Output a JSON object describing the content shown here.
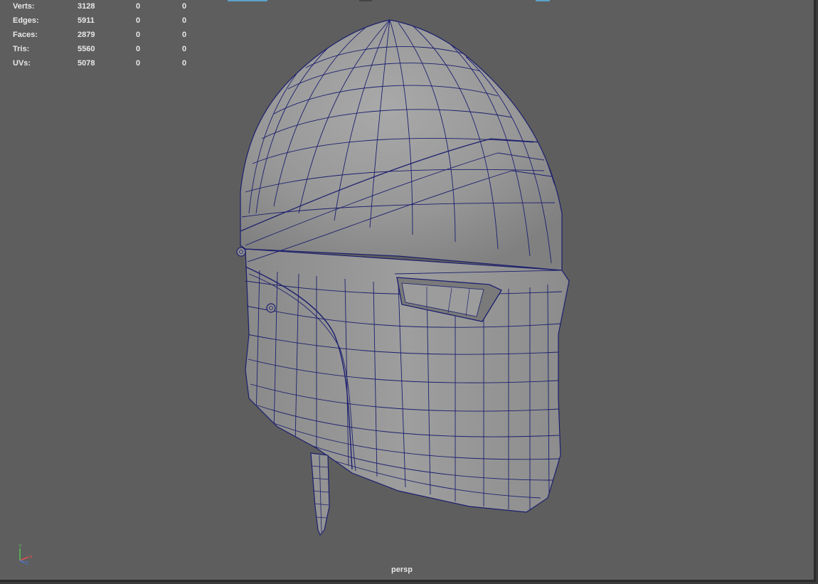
{
  "hud": {
    "rows": [
      {
        "label": "Verts:",
        "value": "3128",
        "selected": "0",
        "selected2": "0"
      },
      {
        "label": "Edges:",
        "value": "5911",
        "selected": "0",
        "selected2": "0"
      },
      {
        "label": "Faces:",
        "value": "2879",
        "selected": "0",
        "selected2": "0"
      },
      {
        "label": "Tris:",
        "value": "5560",
        "selected": "0",
        "selected2": "0"
      },
      {
        "label": "UVs:",
        "value": "5078",
        "selected": "0",
        "selected2": "0"
      }
    ]
  },
  "viewport": {
    "camera": "persp",
    "background_color": "#5e5e5e",
    "wire_color": "#1c1f6e",
    "shade_color": "#9a9a9a"
  },
  "axis": {
    "y": "Y",
    "x": "X",
    "z": "Z"
  }
}
